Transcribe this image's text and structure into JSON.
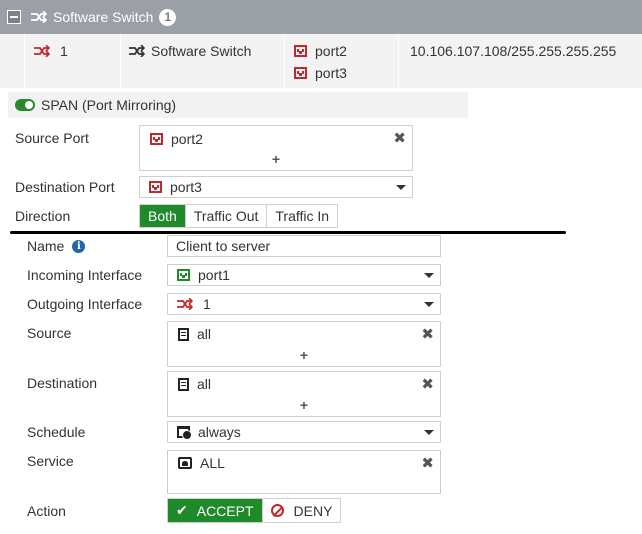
{
  "group": {
    "title": "Software Switch",
    "count": "1"
  },
  "row": {
    "name": "1",
    "type": "Software Switch",
    "members": [
      "port2",
      "port3"
    ],
    "ip": "10.106.107.108/255.255.255.255"
  },
  "span": {
    "label": "SPAN (Port Mirroring)",
    "enabled": true,
    "source_port_label": "Source Port",
    "source_port_value": "port2",
    "destination_port_label": "Destination Port",
    "destination_port_value": "port3",
    "direction_label": "Direction",
    "direction_options": [
      "Both",
      "Traffic Out",
      "Traffic In"
    ],
    "direction_selected": "Both"
  },
  "policy": {
    "name_label": "Name",
    "name_value": "Client to server",
    "incoming_label": "Incoming Interface",
    "incoming_value": "port1",
    "outgoing_label": "Outgoing Interface",
    "outgoing_value": "1",
    "source_label": "Source",
    "source_value": "all",
    "destination_label": "Destination",
    "destination_value": "all",
    "schedule_label": "Schedule",
    "schedule_value": "always",
    "service_label": "Service",
    "service_value": "ALL",
    "action_label": "Action",
    "accept_label": "ACCEPT",
    "deny_label": "DENY",
    "action_selected": "ACCEPT"
  },
  "glyphs": {
    "plus": "+",
    "remove": "✖",
    "info": "i",
    "check": "✔"
  },
  "colors": {
    "accent_green": "#1f8a2a",
    "port_red": "#c0282d",
    "header_gray": "#9aa0a6",
    "info_blue": "#2266aa"
  }
}
